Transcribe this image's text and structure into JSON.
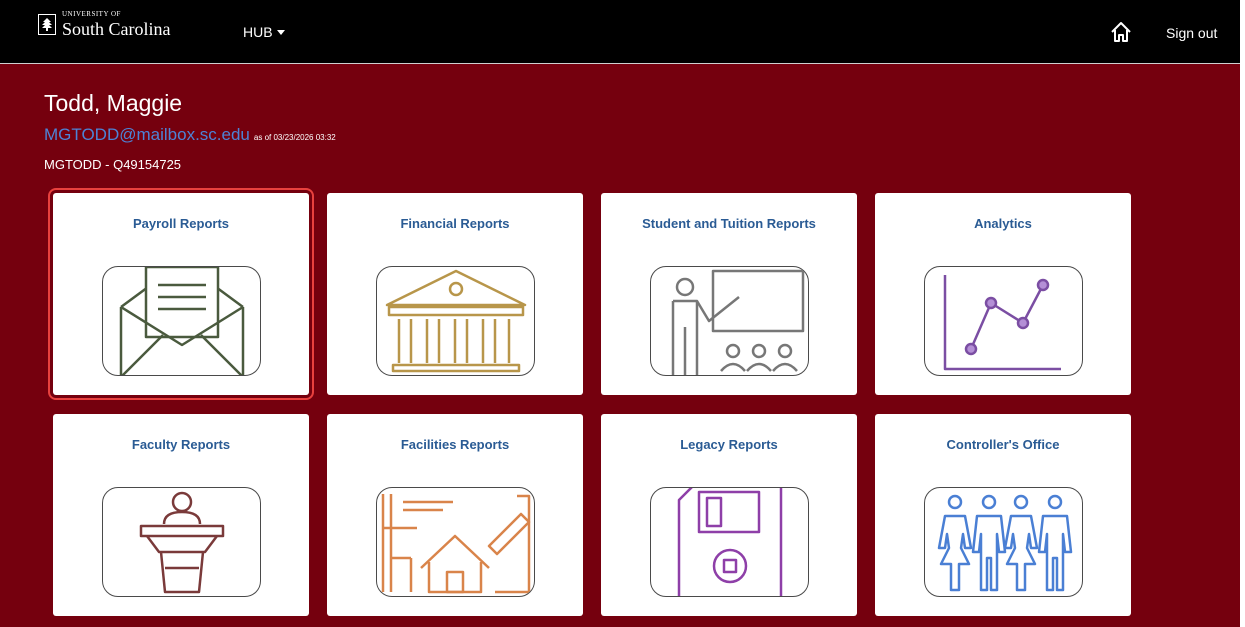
{
  "header": {
    "logo_small": "UNIVERSITY OF",
    "logo_name": "South Carolina",
    "hub_label": "HUB",
    "signout_label": "Sign out"
  },
  "user": {
    "name": "Todd, Maggie",
    "email": "MGTODD@mailbox.sc.edu",
    "as_of": "as of 03/23/2026 03:32",
    "id_line": "MGTODD - Q49154725"
  },
  "tiles": [
    {
      "title": "Payroll Reports",
      "icon": "envelope-icon",
      "color": "#4a5a3e"
    },
    {
      "title": "Financial Reports",
      "icon": "bank-icon",
      "color": "#b8964a"
    },
    {
      "title": "Student and Tuition Reports",
      "icon": "teacher-icon",
      "color": "#777777"
    },
    {
      "title": "Analytics",
      "icon": "line-chart-icon",
      "color": "#7b4ea3"
    },
    {
      "title": "Faculty Reports",
      "icon": "podium-icon",
      "color": "#7a3a3a"
    },
    {
      "title": "Facilities Reports",
      "icon": "house-blueprint-icon",
      "color": "#d9844a"
    },
    {
      "title": "Legacy Reports",
      "icon": "floppy-disk-icon",
      "color": "#8e3fa8"
    },
    {
      "title": "Controller's Office",
      "icon": "people-icon",
      "color": "#4a7fd4"
    }
  ],
  "colors": {
    "header_bg": "#000000",
    "main_bg": "#75000e",
    "link": "#4d83d6",
    "tile_title": "#2a5b94",
    "selection": "#e8413e"
  }
}
